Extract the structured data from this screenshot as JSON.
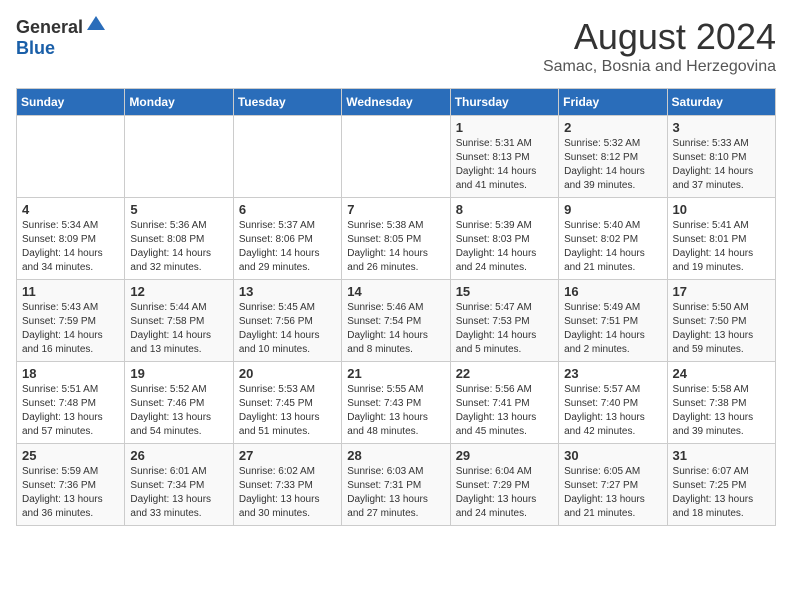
{
  "header": {
    "logo_general": "General",
    "logo_blue": "Blue",
    "month_title": "August 2024",
    "subtitle": "Samac, Bosnia and Herzegovina"
  },
  "weekdays": [
    "Sunday",
    "Monday",
    "Tuesday",
    "Wednesday",
    "Thursday",
    "Friday",
    "Saturday"
  ],
  "weeks": [
    [
      {
        "day": "",
        "info": ""
      },
      {
        "day": "",
        "info": ""
      },
      {
        "day": "",
        "info": ""
      },
      {
        "day": "",
        "info": ""
      },
      {
        "day": "1",
        "info": "Sunrise: 5:31 AM\nSunset: 8:13 PM\nDaylight: 14 hours\nand 41 minutes."
      },
      {
        "day": "2",
        "info": "Sunrise: 5:32 AM\nSunset: 8:12 PM\nDaylight: 14 hours\nand 39 minutes."
      },
      {
        "day": "3",
        "info": "Sunrise: 5:33 AM\nSunset: 8:10 PM\nDaylight: 14 hours\nand 37 minutes."
      }
    ],
    [
      {
        "day": "4",
        "info": "Sunrise: 5:34 AM\nSunset: 8:09 PM\nDaylight: 14 hours\nand 34 minutes."
      },
      {
        "day": "5",
        "info": "Sunrise: 5:36 AM\nSunset: 8:08 PM\nDaylight: 14 hours\nand 32 minutes."
      },
      {
        "day": "6",
        "info": "Sunrise: 5:37 AM\nSunset: 8:06 PM\nDaylight: 14 hours\nand 29 minutes."
      },
      {
        "day": "7",
        "info": "Sunrise: 5:38 AM\nSunset: 8:05 PM\nDaylight: 14 hours\nand 26 minutes."
      },
      {
        "day": "8",
        "info": "Sunrise: 5:39 AM\nSunset: 8:03 PM\nDaylight: 14 hours\nand 24 minutes."
      },
      {
        "day": "9",
        "info": "Sunrise: 5:40 AM\nSunset: 8:02 PM\nDaylight: 14 hours\nand 21 minutes."
      },
      {
        "day": "10",
        "info": "Sunrise: 5:41 AM\nSunset: 8:01 PM\nDaylight: 14 hours\nand 19 minutes."
      }
    ],
    [
      {
        "day": "11",
        "info": "Sunrise: 5:43 AM\nSunset: 7:59 PM\nDaylight: 14 hours\nand 16 minutes."
      },
      {
        "day": "12",
        "info": "Sunrise: 5:44 AM\nSunset: 7:58 PM\nDaylight: 14 hours\nand 13 minutes."
      },
      {
        "day": "13",
        "info": "Sunrise: 5:45 AM\nSunset: 7:56 PM\nDaylight: 14 hours\nand 10 minutes."
      },
      {
        "day": "14",
        "info": "Sunrise: 5:46 AM\nSunset: 7:54 PM\nDaylight: 14 hours\nand 8 minutes."
      },
      {
        "day": "15",
        "info": "Sunrise: 5:47 AM\nSunset: 7:53 PM\nDaylight: 14 hours\nand 5 minutes."
      },
      {
        "day": "16",
        "info": "Sunrise: 5:49 AM\nSunset: 7:51 PM\nDaylight: 14 hours\nand 2 minutes."
      },
      {
        "day": "17",
        "info": "Sunrise: 5:50 AM\nSunset: 7:50 PM\nDaylight: 13 hours\nand 59 minutes."
      }
    ],
    [
      {
        "day": "18",
        "info": "Sunrise: 5:51 AM\nSunset: 7:48 PM\nDaylight: 13 hours\nand 57 minutes."
      },
      {
        "day": "19",
        "info": "Sunrise: 5:52 AM\nSunset: 7:46 PM\nDaylight: 13 hours\nand 54 minutes."
      },
      {
        "day": "20",
        "info": "Sunrise: 5:53 AM\nSunset: 7:45 PM\nDaylight: 13 hours\nand 51 minutes."
      },
      {
        "day": "21",
        "info": "Sunrise: 5:55 AM\nSunset: 7:43 PM\nDaylight: 13 hours\nand 48 minutes."
      },
      {
        "day": "22",
        "info": "Sunrise: 5:56 AM\nSunset: 7:41 PM\nDaylight: 13 hours\nand 45 minutes."
      },
      {
        "day": "23",
        "info": "Sunrise: 5:57 AM\nSunset: 7:40 PM\nDaylight: 13 hours\nand 42 minutes."
      },
      {
        "day": "24",
        "info": "Sunrise: 5:58 AM\nSunset: 7:38 PM\nDaylight: 13 hours\nand 39 minutes."
      }
    ],
    [
      {
        "day": "25",
        "info": "Sunrise: 5:59 AM\nSunset: 7:36 PM\nDaylight: 13 hours\nand 36 minutes."
      },
      {
        "day": "26",
        "info": "Sunrise: 6:01 AM\nSunset: 7:34 PM\nDaylight: 13 hours\nand 33 minutes."
      },
      {
        "day": "27",
        "info": "Sunrise: 6:02 AM\nSunset: 7:33 PM\nDaylight: 13 hours\nand 30 minutes."
      },
      {
        "day": "28",
        "info": "Sunrise: 6:03 AM\nSunset: 7:31 PM\nDaylight: 13 hours\nand 27 minutes."
      },
      {
        "day": "29",
        "info": "Sunrise: 6:04 AM\nSunset: 7:29 PM\nDaylight: 13 hours\nand 24 minutes."
      },
      {
        "day": "30",
        "info": "Sunrise: 6:05 AM\nSunset: 7:27 PM\nDaylight: 13 hours\nand 21 minutes."
      },
      {
        "day": "31",
        "info": "Sunrise: 6:07 AM\nSunset: 7:25 PM\nDaylight: 13 hours\nand 18 minutes."
      }
    ]
  ]
}
